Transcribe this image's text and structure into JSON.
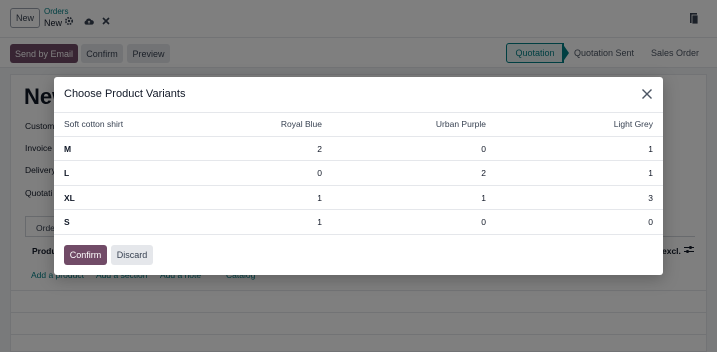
{
  "header": {
    "new_label": "New",
    "breadcrumb_parent": "Orders",
    "breadcrumb_current": "New"
  },
  "actions": {
    "send_email": "Send by Email",
    "confirm": "Confirm",
    "preview": "Preview"
  },
  "statusbar": {
    "steps": [
      "Quotation",
      "Quotation Sent",
      "Sales Order"
    ],
    "active": "Quotation"
  },
  "form": {
    "title": "New",
    "labels": [
      "Custom",
      "Invoice",
      "Delivery",
      "Quotati"
    ],
    "tab": "Orde",
    "column_product": "Produ",
    "column_excl": "excl.",
    "links": [
      "Add a product",
      "Add a section",
      "Add a note",
      "Catalog"
    ]
  },
  "modal": {
    "title": "Choose Product Variants",
    "product": "Soft cotton shirt",
    "columns": [
      "Royal Blue",
      "Urban Purple",
      "Light Grey"
    ],
    "rows": [
      {
        "label": "M",
        "values": [
          "2",
          "0",
          "1"
        ]
      },
      {
        "label": "L",
        "values": [
          "0",
          "2",
          "1"
        ]
      },
      {
        "label": "XL",
        "values": [
          "1",
          "1",
          "3"
        ]
      },
      {
        "label": "S",
        "values": [
          "1",
          "0",
          "0"
        ]
      }
    ],
    "confirm_label": "Confirm",
    "discard_label": "Discard"
  },
  "colors": {
    "brand": "#714b67",
    "accent": "#017e84"
  }
}
